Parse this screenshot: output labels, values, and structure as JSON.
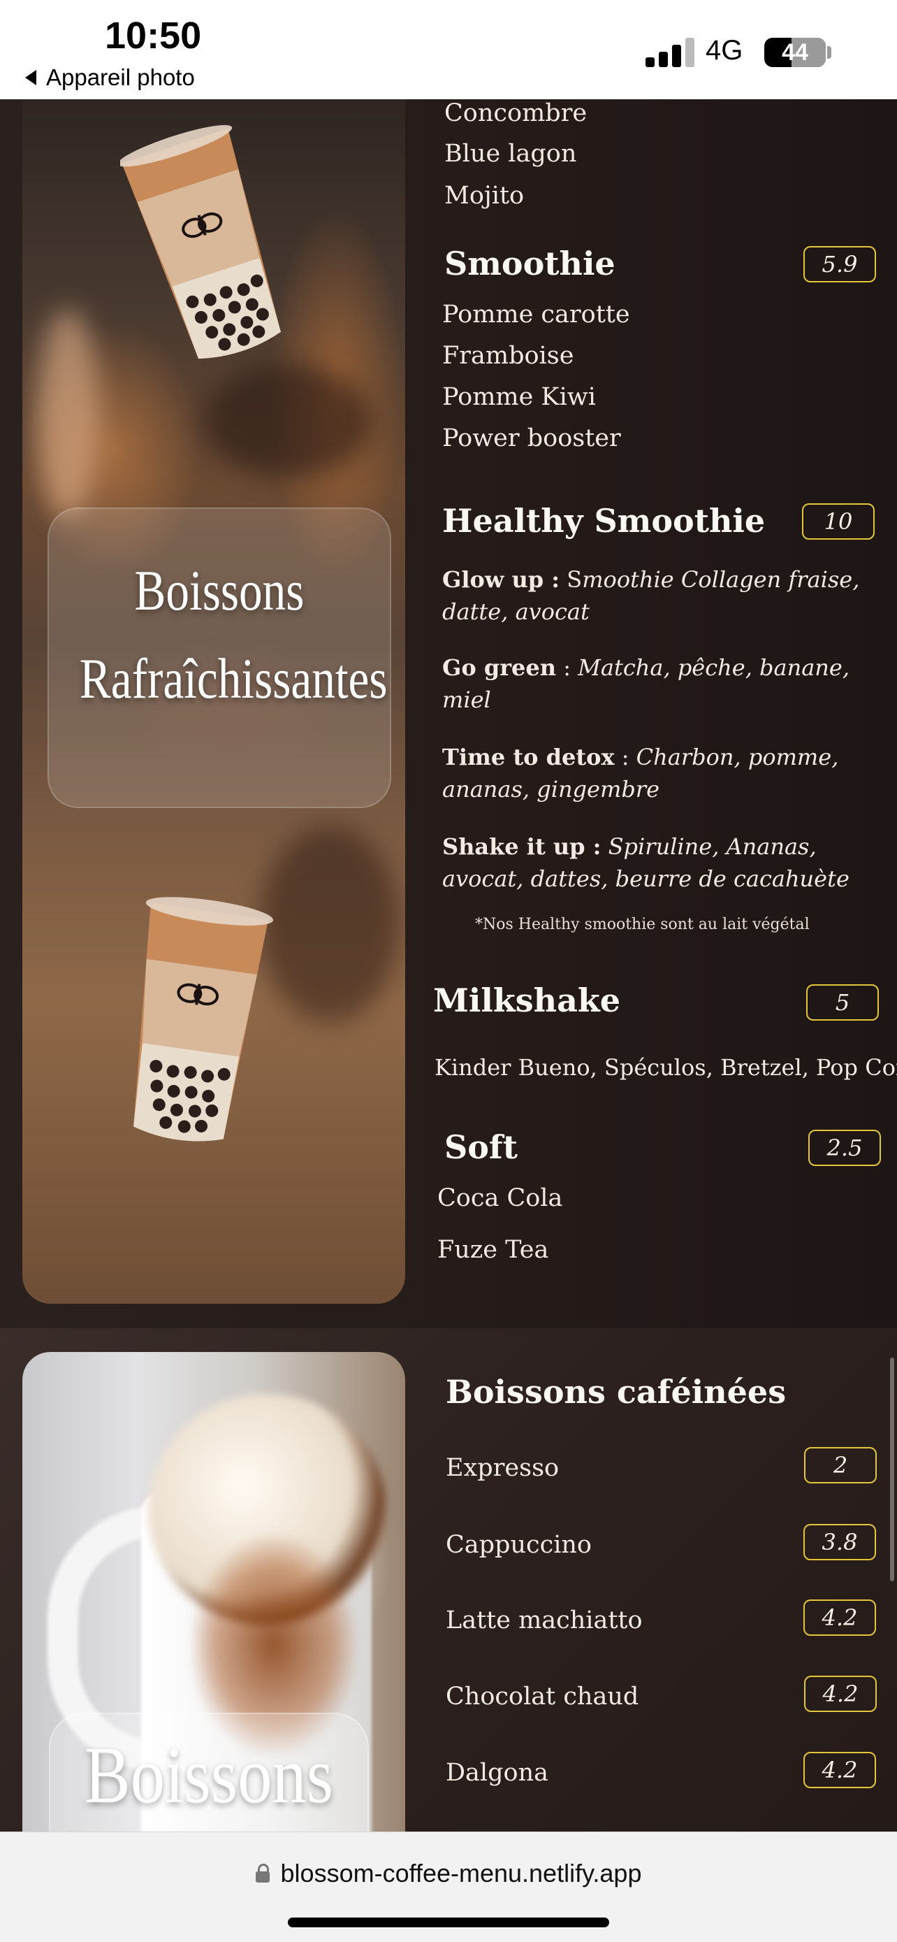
{
  "status_bar": {
    "time": "10:50",
    "back_label": "Appareil photo",
    "network": "4G",
    "battery": "44",
    "battery_level": 0.44
  },
  "refreshing": {
    "panel_title_line1": "Boissons",
    "panel_title_line2": "Rafraîchissantes",
    "prev_items": [
      "Concombre",
      "Blue lagon",
      "Mojito"
    ],
    "smoothie": {
      "title": "Smoothie",
      "price": "5.9",
      "items": [
        "Pomme carotte",
        "Framboise",
        "Pomme Kiwi",
        "Power booster"
      ]
    },
    "healthy": {
      "title": "Healthy Smoothie",
      "price": "10",
      "entries": [
        {
          "name": "Glow up :",
          "text_normal": " S",
          "text_italic": "moothie Collagen fraise,",
          "text_line2": "datte, avocat"
        },
        {
          "name": "Go green",
          "sep": " : ",
          "text_italic": "Matcha, pêche, banane,",
          "text_line2": "miel"
        },
        {
          "name": "Time to detox",
          "sep": " : ",
          "text_italic": "Charbon, pomme,",
          "text_line2": "ananas, gingembre"
        },
        {
          "name": "Shake it up :",
          "sep": " ",
          "text_italic": "Spiruline, Ananas,",
          "text_line2": "avocat, dattes, beurre de cacahuète"
        }
      ],
      "note": "*Nos Healthy smoothie sont au lait végétal"
    },
    "milkshake": {
      "title": "Milkshake",
      "price": "5",
      "items": "Kinder Bueno, Spéculos, Bretzel, Pop Corn"
    },
    "soft": {
      "title": "Soft",
      "price": "2.5",
      "items": [
        "Coca Cola",
        "Fuze Tea"
      ]
    }
  },
  "caffeinated": {
    "panel_title": "Boissons",
    "title": "Boissons caféinées",
    "items": [
      {
        "name": "Expresso",
        "price": "2"
      },
      {
        "name": "Cappuccino",
        "price": "3.8"
      },
      {
        "name": "Latte machiatto",
        "price": "4.2"
      },
      {
        "name": "Chocolat chaud",
        "price": "4.2"
      },
      {
        "name": "Dalgona",
        "price": "4.2"
      }
    ]
  },
  "browser": {
    "url": "blossom-coffee-menu.netlify.app"
  },
  "colors": {
    "price_border": "#e3c63a",
    "background": "#221a18",
    "text": "#f1ebe4"
  }
}
